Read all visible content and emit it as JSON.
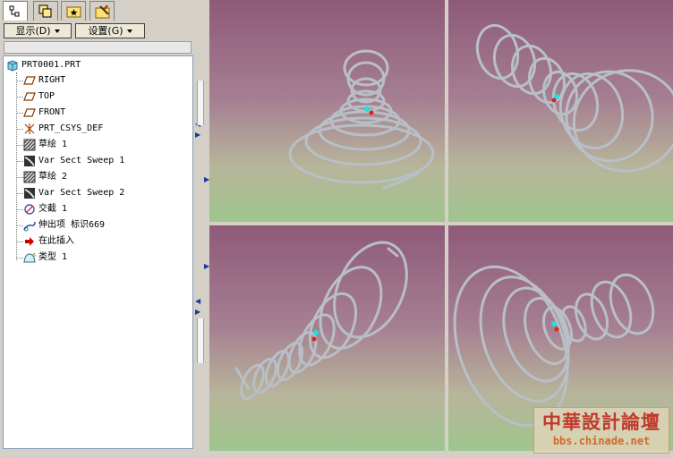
{
  "toolbar": {
    "display_menu": "显示(D)",
    "settings_menu": "设置(G)"
  },
  "model_tree": {
    "root": "PRT0001.PRT",
    "items": [
      {
        "label": "RIGHT",
        "icon": "datum-plane-icon"
      },
      {
        "label": "TOP",
        "icon": "datum-plane-icon"
      },
      {
        "label": "FRONT",
        "icon": "datum-plane-icon"
      },
      {
        "label": "PRT_CSYS_DEF",
        "icon": "coordinate-system-icon"
      },
      {
        "label": "草绘 1",
        "icon": "sketch-icon"
      },
      {
        "label": "Var Sect Sweep 1",
        "icon": "sweep-icon"
      },
      {
        "label": "草绘 2",
        "icon": "sketch-icon"
      },
      {
        "label": "Var Sect Sweep 2",
        "icon": "sweep-icon"
      },
      {
        "label": "交截 1",
        "icon": "intersect-icon"
      },
      {
        "label": "伸出项 标识669",
        "icon": "protrusion-icon"
      },
      {
        "label": "在此插入",
        "icon": "insert-here-arrow-icon"
      },
      {
        "label": "类型 1",
        "icon": "feature-type-icon"
      }
    ]
  },
  "watermark": {
    "title": "中華設計論壇",
    "url": "bbs.chinade.net"
  },
  "colors": {
    "viewport_top": "#8e5a78",
    "viewport_bottom": "#9fc58e",
    "spring": "#bfc6ce",
    "insert_arrow": "#cc0000"
  }
}
